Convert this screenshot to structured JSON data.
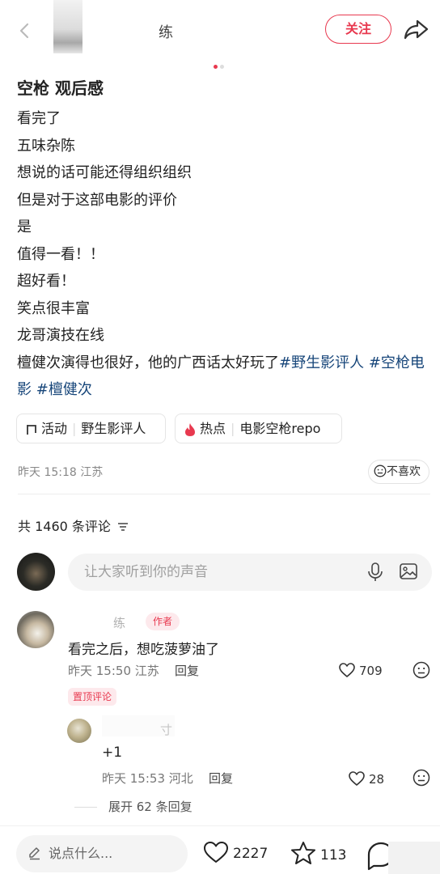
{
  "header": {
    "author_name": "练",
    "follow_label": "关注"
  },
  "post": {
    "title": "空枪 观后感",
    "lines": [
      "看完了",
      "五味杂陈",
      "想说的话可能还得组织组织",
      "但是对于这部电影的评价",
      "是",
      "值得一看！！",
      "超好看！",
      "笑点很丰富",
      "龙哥演技在线"
    ],
    "last_line_text": "檀健次演得也很好，他的广西话太好玩了",
    "tags": [
      "#野生影评人",
      "#空枪电影",
      "#檀健次"
    ],
    "chips": [
      {
        "prefix": "活动",
        "label": "野生影评人"
      },
      {
        "prefix": "热点",
        "label": "电影空枪repo"
      }
    ],
    "meta": "昨天 15:18 江苏",
    "dislike_label": "不喜欢"
  },
  "comments_header": {
    "label": "共 1460 条评论"
  },
  "input": {
    "placeholder": "让大家听到你的声音"
  },
  "comment": {
    "name": "练",
    "author_tag": "作者",
    "text": "看完之后，想吃菠萝油了",
    "meta": "昨天 15:50 江苏",
    "reply_label": "回复",
    "likes": "709",
    "pinned_label": "置顶评论"
  },
  "reply": {
    "name": "寸",
    "text": "+1",
    "meta": "昨天 15:53 河北",
    "reply_label": "回复",
    "likes": "28"
  },
  "expand_label": "展开 62 条回复",
  "bottom_bar": {
    "say_placeholder": "说点什么...",
    "likes": "2227",
    "stars": "113"
  },
  "colors": {
    "accent": "#e8394f",
    "tag": "#17467a"
  },
  "icons": [
    "back-icon",
    "share-icon",
    "activity-icon",
    "fire-icon",
    "smile-icon",
    "mic-icon",
    "image-icon",
    "heart-icon",
    "emoji-icon",
    "edit-icon",
    "star-icon",
    "comment-icon",
    "sort-icon"
  ]
}
